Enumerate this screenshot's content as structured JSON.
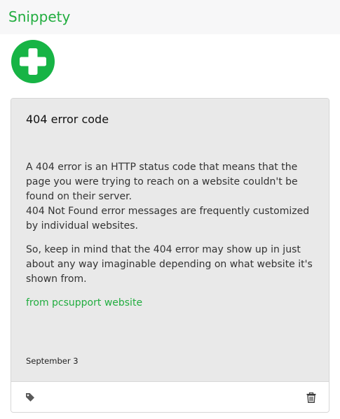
{
  "app": {
    "title": "Snippety",
    "brand_color": "#21ad3f"
  },
  "toolbar": {
    "add_icon": "plus-circle-icon",
    "add_color": "#17b445"
  },
  "snippet": {
    "title": "404 error code",
    "paragraphs": [
      "A 404 error is an HTTP status code that means that the page you were trying to reach on a website couldn't be found on their server.",
      "404 Not Found error messages are frequently customized by individual websites.",
      "So, keep in mind that the 404 error may show up in just about any way imaginable depending on what website it's shown from."
    ],
    "source_link_text": "from pcsupport website",
    "date": "September 3",
    "tag_icon": "tag-icon",
    "delete_icon": "trash-icon"
  }
}
